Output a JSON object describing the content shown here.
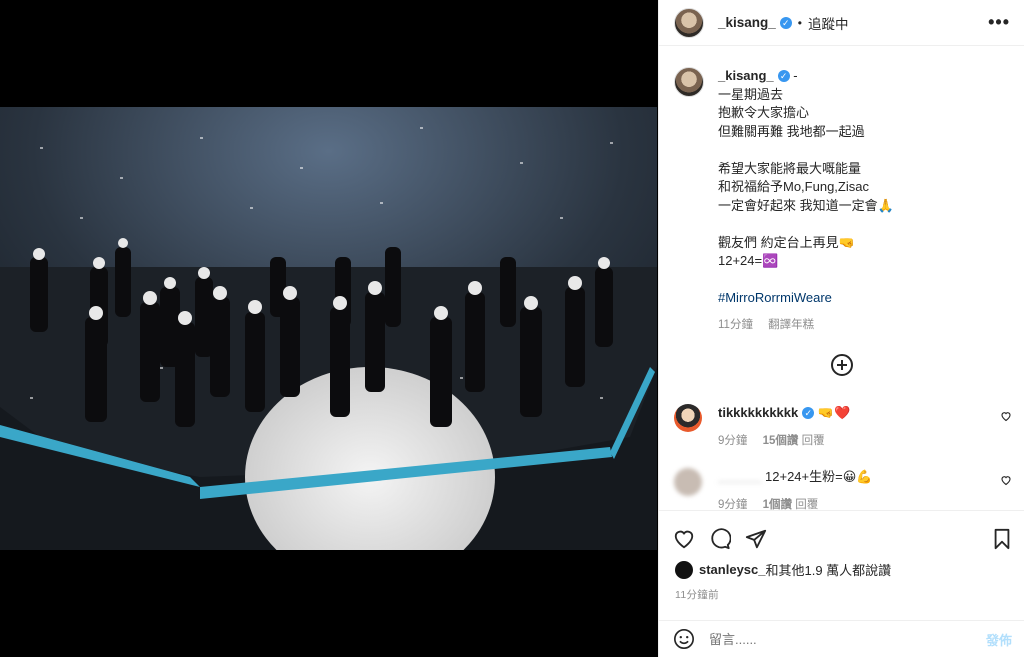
{
  "post": {
    "username": "_kisang_",
    "dot": "•",
    "follow_status": "追蹤中",
    "more": "•••"
  },
  "caption": {
    "username": "_kisang_",
    "dash": "-",
    "lines": [
      "一星期過去",
      "抱歉令大家擔心",
      "但難關再難 我地都一起過",
      "",
      "希望大家能將最大嘅能量",
      "和祝福給予Mo,Fung,Zisac",
      "一定會好起來 我知道一定會🙏",
      "",
      "觀友們 約定台上再見🤜",
      "12+24=♾️",
      ""
    ],
    "hashtag": "#MirroRorrmiWeare",
    "time": "11分鐘",
    "translate": "翻譯年糕"
  },
  "comments": [
    {
      "username": "tikkkkkkkkkk",
      "text": "🤜❤️",
      "time": "9分鐘",
      "likes": "15個讚",
      "reply": "回覆"
    },
    {
      "username": "______",
      "text": "12+24+生粉=😀💪",
      "time": "9分鐘",
      "likes": "1個讚",
      "reply": "回覆"
    }
  ],
  "liked_by": {
    "name": "stanleysc_",
    "text": "和其他1.9 萬人都說讚"
  },
  "time_ago": "11分鐘前",
  "comment_input": {
    "placeholder": "留言......",
    "post_label": "發佈"
  }
}
